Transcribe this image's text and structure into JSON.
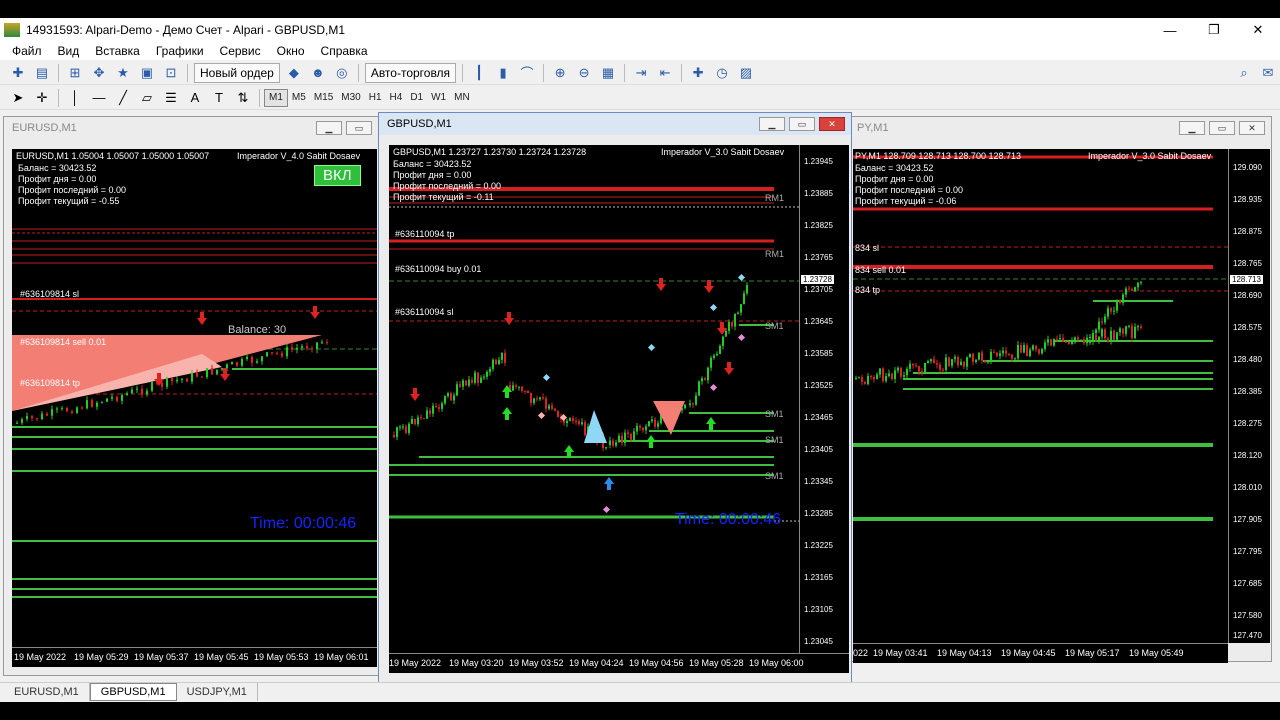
{
  "window": {
    "title": "14931593: Alpari-Demo - Демо Счет - Alpari - GBPUSD,M1"
  },
  "menu": [
    "Файл",
    "Вид",
    "Вставка",
    "Графики",
    "Сервис",
    "Окно",
    "Справка"
  ],
  "toolbar": {
    "new_order": "Новый ордер",
    "auto_trading": "Авто-торговля"
  },
  "timeframes": [
    "M1",
    "M5",
    "M15",
    "M30",
    "H1",
    "H4",
    "D1",
    "W1",
    "MN"
  ],
  "active_timeframe": "M1",
  "charts": {
    "eurusd": {
      "window_title": "EURUSD,M1",
      "header": "EURUSD,M1  1.05004 1.05007 1.05000 1.05007",
      "indicator": "Imperador V_4.0 Sabit Dosaev",
      "balance": "Баланс = 30423.52",
      "profit_day": "Профит дня = 0.00",
      "profit_last": "Профит последний = 0.00",
      "profit_current": "Профит текущий = -0.55",
      "vkl_button": "ВКЛ",
      "order_sl": "#636109814 sl",
      "order_sell": "#636109814 sell 0.01",
      "order_tp": "#636109814 tp",
      "balance_label": "Balance: 30",
      "timer": "Time: 00:00:46",
      "time_labels": [
        "19 May 2022",
        "19 May 05:29",
        "19 May 05:37",
        "19 May 05:45",
        "19 May 05:53",
        "19 May 06:01"
      ]
    },
    "gbpusd": {
      "window_title": "GBPUSD,M1",
      "header": "GBPUSD,M1  1.23727 1.23730 1.23724 1.23728",
      "indicator": "Imperador V_3.0 Sabit Dosaev",
      "balance": "Баланс = 30423.52",
      "profit_day": "Профит дня = 0.00",
      "profit_last": "Профит последний = 0.00",
      "profit_current": "Профит текущий = -0.11",
      "order_tp": "#636110094 tp",
      "order_buy": "#636110094 buy 0.01",
      "order_sl": "#636110094 sl",
      "timer": "Time: 00:00:46",
      "current_price": "1.23728",
      "rm_label": "RM1",
      "sm_label": "SM1",
      "price_labels": [
        "1.23945",
        "1.23885",
        "1.23825",
        "1.23765",
        "1.23705",
        "1.23645",
        "1.23585",
        "1.23525",
        "1.23465",
        "1.23405",
        "1.23345",
        "1.23285",
        "1.23225",
        "1.23165",
        "1.23105",
        "1.23045"
      ],
      "time_labels": [
        "19 May 2022",
        "19 May 03:20",
        "19 May 03:52",
        "19 May 04:24",
        "19 May 04:56",
        "19 May 05:28",
        "19 May 06:00"
      ]
    },
    "usdjpy": {
      "window_title": "PY,M1",
      "header": "PY,M1  128.709 128.713 128.700 128.713",
      "indicator": "Imperador V_3.0 Sabit Dosaev",
      "balance": "Баланс = 30423.52",
      "profit_day": "Профит дня = 0.00",
      "profit_last": "Профит последний = 0.00",
      "profit_current": "Профит текущий = -0.06",
      "order_sl": "834 sl",
      "order_sell": "834 sell 0.01",
      "order_tp": "834 tp",
      "current_price": "128.713",
      "price_labels": [
        "129.090",
        "128.935",
        "128.875",
        "128.765",
        "128.690",
        "128.575",
        "128.480",
        "128.385",
        "128.275",
        "128.120",
        "128.010",
        "127.905",
        "127.795",
        "127.685",
        "127.580",
        "127.470"
      ],
      "time_labels": [
        "022",
        "19 May 03:41",
        "19 May 04:13",
        "19 May 04:45",
        "19 May 05:17",
        "19 May 05:49"
      ]
    }
  },
  "tabs": [
    "EURUSD,M1",
    "GBPUSD,M1",
    "USDJPY,M1"
  ],
  "active_tab": "GBPUSD,M1",
  "colors": {
    "bull": "#22cc22",
    "bear": "#ee2222",
    "sm": "#3fbf3f",
    "rm": "#d42020",
    "timer": "#1525ff"
  }
}
